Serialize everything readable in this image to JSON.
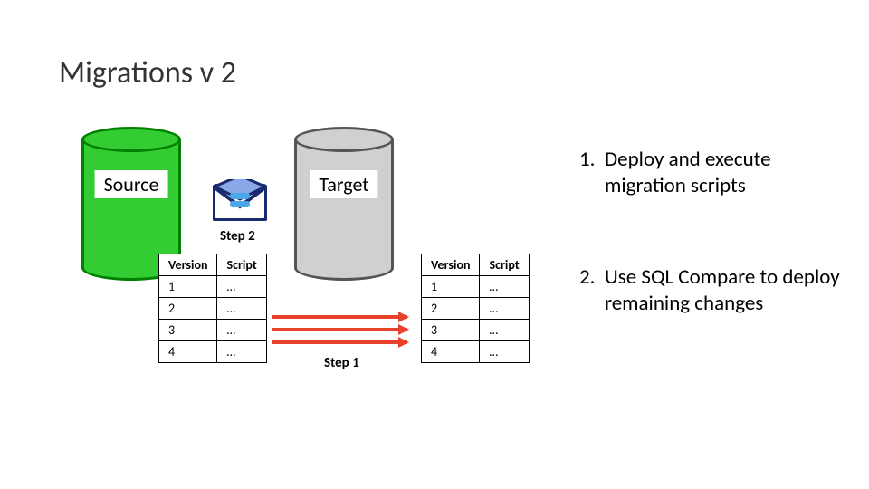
{
  "title": "Migrations v 2",
  "cylinders": {
    "source_label": "Source",
    "target_label": "Target"
  },
  "steps": {
    "step2_label": "Step 2",
    "step1_label": "Step 1"
  },
  "tables": {
    "headers": {
      "version": "Version",
      "script": "Script"
    },
    "left_rows": [
      {
        "version": "1",
        "script": "…"
      },
      {
        "version": "2",
        "script": "…"
      },
      {
        "version": "3",
        "script": "…"
      },
      {
        "version": "4",
        "script": "…"
      }
    ],
    "right_rows": [
      {
        "version": "1",
        "script": "…"
      },
      {
        "version": "2",
        "script": "…"
      },
      {
        "version": "3",
        "script": "…"
      },
      {
        "version": "4",
        "script": "…"
      }
    ]
  },
  "points": {
    "one": {
      "num": "1.",
      "text": "Deploy and execute migration scripts"
    },
    "two": {
      "num": "2.",
      "text": "Use SQL Compare to deploy remaining changes"
    }
  }
}
